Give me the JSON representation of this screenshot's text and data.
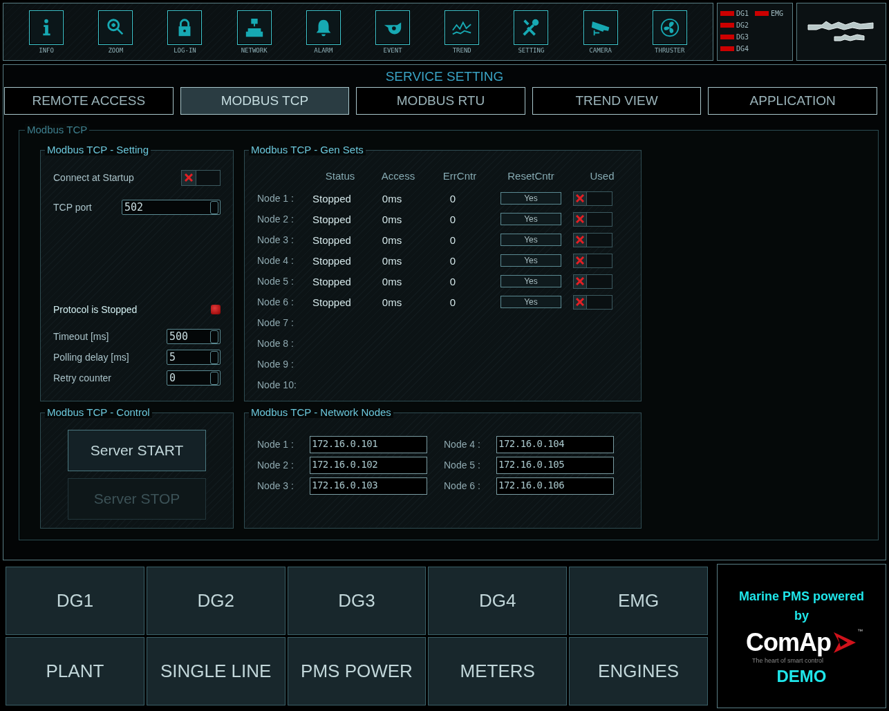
{
  "toolbar": [
    {
      "label": "INFO"
    },
    {
      "label": "ZOOM"
    },
    {
      "label": "LOG-IN"
    },
    {
      "label": "NETWORK"
    },
    {
      "label": "ALARM"
    },
    {
      "label": "EVENT"
    },
    {
      "label": "TREND"
    },
    {
      "label": "SETTING"
    },
    {
      "label": "CAMERA"
    },
    {
      "label": "THRUSTER"
    }
  ],
  "legend": [
    {
      "label": "DG1",
      "color": "#cc0000"
    },
    {
      "label": "DG2",
      "color": "#cc0000"
    },
    {
      "label": "DG3",
      "color": "#cc0000"
    },
    {
      "label": "DG4",
      "color": "#cc0000"
    },
    {
      "label": "EMG",
      "color": "#cc0000"
    }
  ],
  "page_title": "SERVICE SETTING",
  "tabs": [
    {
      "label": "REMOTE ACCESS",
      "selected": false
    },
    {
      "label": "MODBUS TCP",
      "selected": true
    },
    {
      "label": "MODBUS RTU",
      "selected": false
    },
    {
      "label": "TREND VIEW",
      "selected": false
    },
    {
      "label": "APPLICATION",
      "selected": false
    }
  ],
  "group_title": "Modbus TCP",
  "setting": {
    "title": "Modbus TCP - Setting",
    "connect_label": "Connect at Startup",
    "connect_checked": false,
    "port_label": "TCP port",
    "port_value": "502",
    "protocol_label": "Protocol is Stopped",
    "protocol_running": false,
    "fields": [
      {
        "label": "Timeout [ms]",
        "value": "500"
      },
      {
        "label": "Polling delay [ms]",
        "value": "5"
      },
      {
        "label": "Retry counter",
        "value": "0"
      }
    ]
  },
  "gen_sets": {
    "title": "Modbus TCP - Gen Sets",
    "columns": [
      "Status",
      "Access",
      "ErrCntr",
      "ResetCntr",
      "Used"
    ],
    "rows": [
      {
        "label": "Node 1 :",
        "status": "Stopped",
        "access": "0ms",
        "errors": "0",
        "reset": "Yes",
        "used": false
      },
      {
        "label": "Node 2 :",
        "status": "Stopped",
        "access": "0ms",
        "errors": "0",
        "reset": "Yes",
        "used": false
      },
      {
        "label": "Node 3 :",
        "status": "Stopped",
        "access": "0ms",
        "errors": "0",
        "reset": "Yes",
        "used": false
      },
      {
        "label": "Node 4 :",
        "status": "Stopped",
        "access": "0ms",
        "errors": "0",
        "reset": "Yes",
        "used": false
      },
      {
        "label": "Node 5 :",
        "status": "Stopped",
        "access": "0ms",
        "errors": "0",
        "reset": "Yes",
        "used": false
      },
      {
        "label": "Node 6 :",
        "status": "Stopped",
        "access": "0ms",
        "errors": "0",
        "reset": "Yes",
        "used": false
      },
      {
        "label": "Node 7 :"
      },
      {
        "label": "Node 8 :"
      },
      {
        "label": "Node 9 :"
      },
      {
        "label": "Node 10:"
      }
    ]
  },
  "control": {
    "title": "Modbus TCP - Control",
    "buttons": [
      {
        "label": "Server START",
        "disabled": false
      },
      {
        "label": "Server STOP",
        "disabled": true
      }
    ]
  },
  "network": {
    "title": "Modbus TCP - Network Nodes",
    "nodes": [
      {
        "label": "Node 1 :",
        "value": "172.16.0.101"
      },
      {
        "label": "Node 2 :",
        "value": "172.16.0.102"
      },
      {
        "label": "Node 3 :",
        "value": "172.16.0.103"
      },
      {
        "label": "Node 4 :",
        "value": "172.16.0.104"
      },
      {
        "label": "Node 5 :",
        "value": "172.16.0.105"
      },
      {
        "label": "Node 6 :",
        "value": "172.16.0.106"
      }
    ]
  },
  "nav": [
    "DG1",
    "DG2",
    "DG3",
    "DG4",
    "EMG",
    "PLANT",
    "SINGLE LINE",
    "PMS POWER",
    "METERS",
    "ENGINES"
  ],
  "brand": {
    "headline": "Marine PMS powered by",
    "logo": "ComAp",
    "tm": "™",
    "tagline": "The heart of smart control",
    "edition": "DEMO"
  }
}
